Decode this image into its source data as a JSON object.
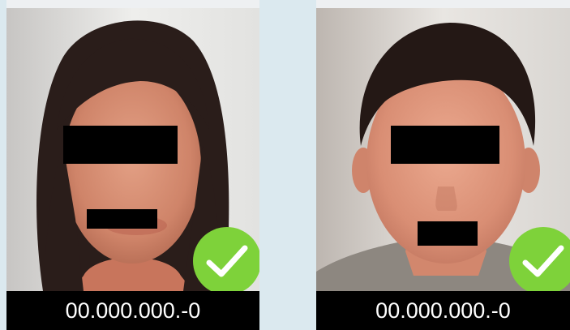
{
  "colors": {
    "verified_check": "#7ed23a",
    "caption_background": "#000000",
    "caption_text": "#ffffff",
    "page_background": "#dbe9ef"
  },
  "cards": [
    {
      "id_number": "00.000.000.-0",
      "status_icon": "checkmark-verified-icon"
    },
    {
      "id_number": "00.000.000.-0",
      "status_icon": "checkmark-verified-icon"
    }
  ]
}
